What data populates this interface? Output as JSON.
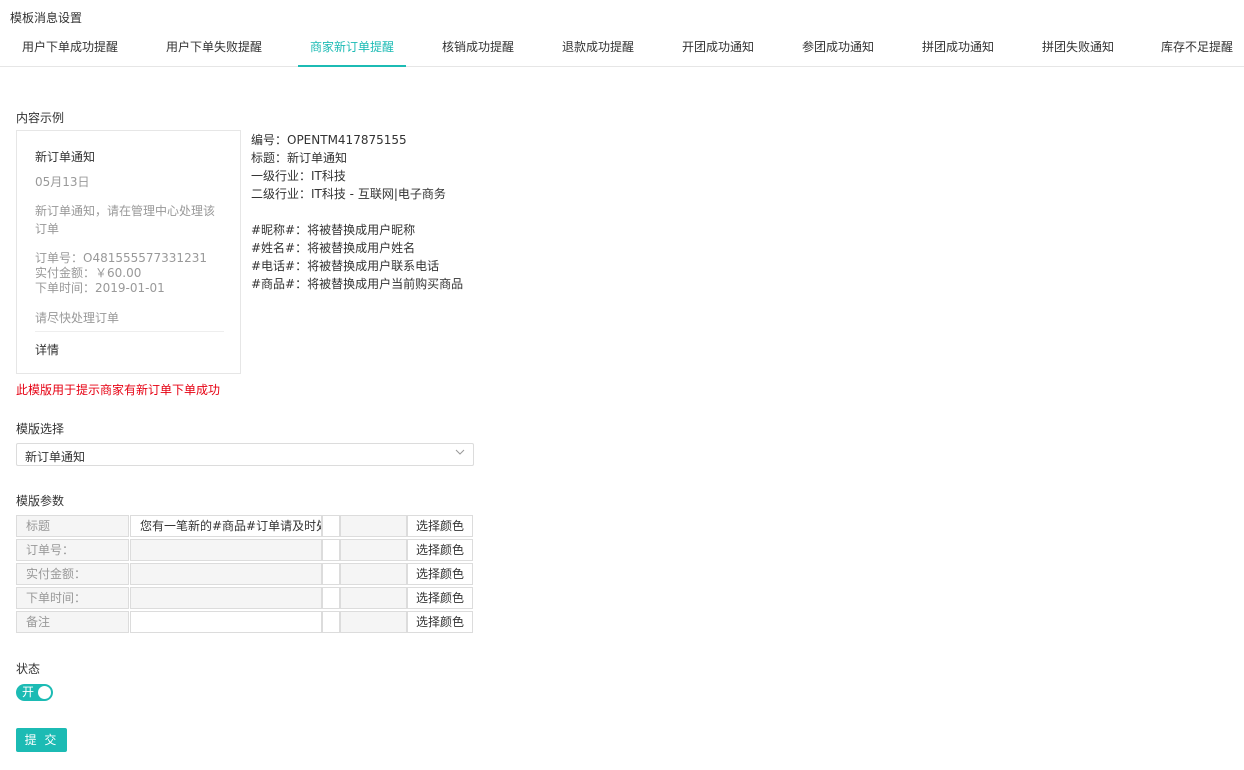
{
  "page_title": "模板消息设置",
  "tabs": [
    {
      "label": "用户下单成功提醒"
    },
    {
      "label": "用户下单失败提醒"
    },
    {
      "label": "商家新订单提醒",
      "active": true
    },
    {
      "label": "核销成功提醒"
    },
    {
      "label": "退款成功提醒"
    },
    {
      "label": "开团成功通知"
    },
    {
      "label": "参团成功通知"
    },
    {
      "label": "拼团成功通知"
    },
    {
      "label": "拼团失败通知"
    },
    {
      "label": "库存不足提醒"
    }
  ],
  "content_example": {
    "label": "内容示例",
    "card": {
      "title": "新订单通知",
      "date": "05月13日",
      "description": "新订单通知，请在管理中心处理该订单",
      "order_no": "订单号：O481555577331231",
      "paid_amount": "实付金额：￥60.00",
      "order_time": "下单时间：2019-01-01",
      "remark": "请尽快处理订单",
      "detail": "详情"
    },
    "info": {
      "code": "编号：OPENTM417875155",
      "title": "标题：新订单通知",
      "industry1": "一级行业：IT科技",
      "industry2": "二级行业：IT科技 - 互联网|电子商务",
      "var_nickname": "#昵称#：将被替换成用户昵称",
      "var_name": "#姓名#：将被替换成用户姓名",
      "var_phone": "#电话#：将被替换成用户联系电话",
      "var_goods": "#商品#：将被替换成用户当前购买商品"
    },
    "hint": "此模版用于提示商家有新订单下单成功"
  },
  "template_select": {
    "label": "模版选择",
    "value": "新订单通知"
  },
  "template_params": {
    "label": "模版参数",
    "color_button_label": "选择颜色",
    "rows": [
      {
        "name": "标题",
        "value": "您有一笔新的#商品#订单请及时处理"
      },
      {
        "name": "订单号：",
        "value": ""
      },
      {
        "name": "实付金额：",
        "value": ""
      },
      {
        "name": "下单时间：",
        "value": ""
      },
      {
        "name": "备注",
        "value": ""
      }
    ]
  },
  "status": {
    "label": "状态",
    "toggle_label": "开"
  },
  "submit_label": "提 交",
  "colors": {
    "accent": "#1cbbb4",
    "warning_text": "#e60012"
  }
}
